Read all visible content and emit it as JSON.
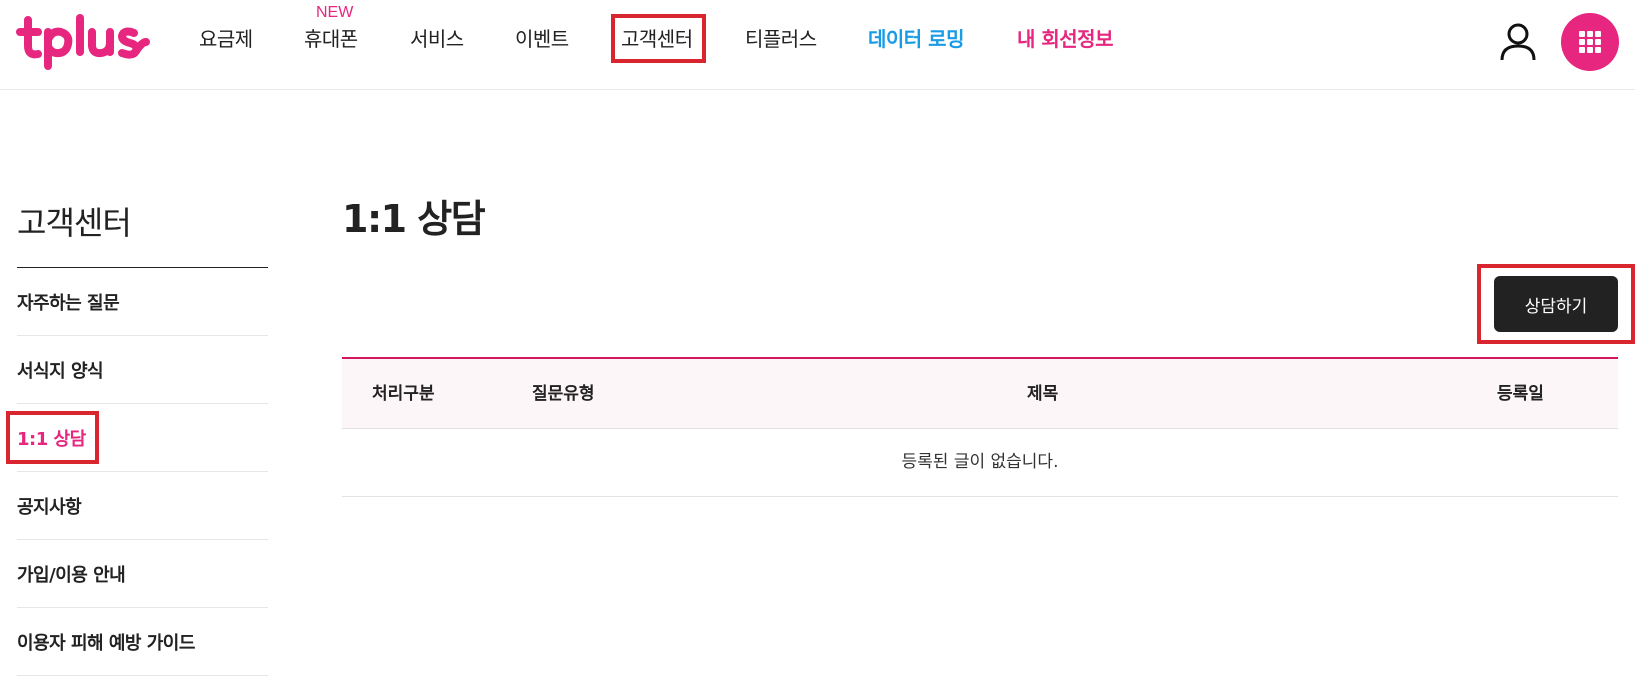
{
  "brand": {
    "logo_text": "tplus",
    "accent": "#e6267f",
    "blue": "#1a9be6"
  },
  "gnb": {
    "new_badge": "NEW",
    "items": [
      "요금제",
      "휴대폰",
      "서비스",
      "이벤트",
      "고객센터",
      "티플러스",
      "데이터 로밍",
      "내 회선정보"
    ]
  },
  "header_icons": {
    "user": "user-icon",
    "apps": "apps-grid-icon"
  },
  "side": {
    "title": "고객센터",
    "items": [
      "자주하는 질문",
      "서식지 양식",
      "1:1 상담",
      "공지사항",
      "가입/이용 안내",
      "이용자 피해 예방 가이드"
    ],
    "active_index": 2
  },
  "main": {
    "title": "1:1 상담",
    "consult_button": "상담하기",
    "table": {
      "headers": [
        "처리구분",
        "질문유형",
        "제목",
        "등록일"
      ],
      "empty_message": "등록된 글이 없습니다."
    }
  }
}
